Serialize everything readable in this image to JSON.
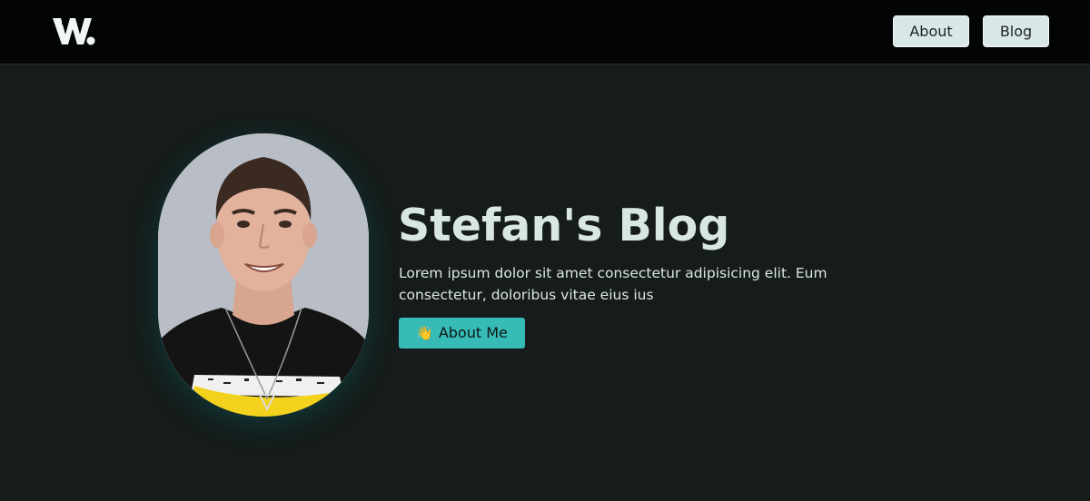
{
  "header": {
    "logo_icon": "w-logo-icon",
    "nav": [
      {
        "label": "About"
      },
      {
        "label": "Blog"
      }
    ]
  },
  "hero": {
    "avatar_icon": "profile-photo",
    "title": "Stefan's Blog",
    "subtitle": "Lorem ipsum dolor sit amet consectetur adipisicing elit. Eum consectetur, doloribus vitae eius ius",
    "cta": {
      "icon": "👋",
      "label": "About Me"
    }
  },
  "colors": {
    "page_bg": "#151c1b",
    "header_bg": "#020405",
    "nav_button_bg": "#d9e7e6",
    "accent": "#36bbb6",
    "title_text": "#d8e6e4"
  }
}
